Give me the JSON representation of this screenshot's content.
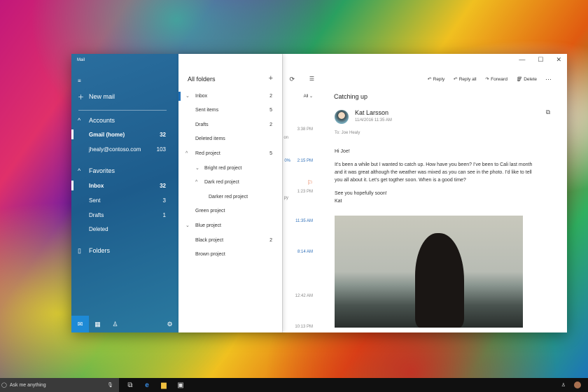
{
  "window": {
    "app_title": "Mail",
    "minimize": "—",
    "maximize": "☐",
    "close": "✕"
  },
  "nav": {
    "menu_icon": "≡",
    "new_mail": "New mail",
    "accounts": "Accounts",
    "account_items": [
      {
        "label": "Gmail (home)",
        "count": "32"
      },
      {
        "label": "jhealy@contoso.com",
        "count": "103"
      }
    ],
    "favorites": "Favorites",
    "favorite_items": [
      {
        "label": "Inbox",
        "count": "32"
      },
      {
        "label": "Sent",
        "count": "3"
      },
      {
        "label": "Drafts",
        "count": "1"
      },
      {
        "label": "Deleted",
        "count": ""
      }
    ],
    "folders": "Folders"
  },
  "folders": {
    "title": "All folders",
    "add": "+",
    "items": [
      {
        "label": "Inbox",
        "count": "2"
      },
      {
        "label": "Sent items",
        "count": "5"
      },
      {
        "label": "Drafts",
        "count": "2"
      },
      {
        "label": "Deleted items",
        "count": ""
      },
      {
        "label": "Red project",
        "count": "5"
      },
      {
        "label": "Bright red project",
        "count": ""
      },
      {
        "label": "Dark red project",
        "count": ""
      },
      {
        "label": "Darker red project",
        "count": ""
      },
      {
        "label": "Green project",
        "count": ""
      },
      {
        "label": "Blue project",
        "count": ""
      },
      {
        "label": "Black project",
        "count": "2"
      },
      {
        "label": "Brown project",
        "count": ""
      }
    ]
  },
  "list": {
    "filter": "All",
    "times": [
      "3:38 PM",
      "2:15 PM",
      "1:23 PM",
      "11:35 AM",
      "8:14 AM",
      "12:42 AM",
      "10:13 PM"
    ],
    "snippets": [
      "on",
      "0%",
      "py"
    ]
  },
  "toolbar": {
    "reply": "Reply",
    "reply_all": "Reply all",
    "forward": "Forward",
    "delete": "Delete",
    "more": "···"
  },
  "message": {
    "subject": "Catching up",
    "from": "Kat Larsson",
    "date": "11/4/2016 11:35 AM",
    "to": "To: Joe Healy",
    "body": [
      "Hi Joe!",
      "It’s been a while but I wanted to catch up. How have you been? I’ve been to Cali last month and it was great although the weather was mixed as you can see in the photo. I’d like to tell you all about it. Let’s get togther soon. When is a good time?",
      "See you hopefully soon!",
      "Kat"
    ]
  },
  "taskbar": {
    "search_placeholder": "Ask me anything"
  }
}
